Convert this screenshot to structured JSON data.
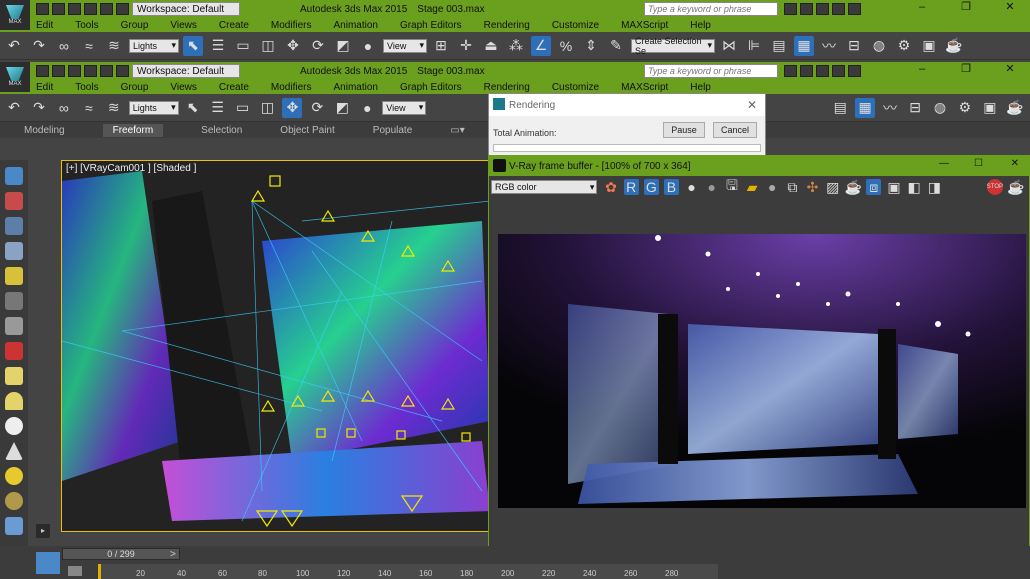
{
  "app": {
    "logo_text": "MAX",
    "workspace": "Workspace: Default",
    "title": "Autodesk 3ds Max  2015",
    "file": "Stage 003.max",
    "search_placeholder": "Type a keyword or phrase",
    "win_min": "–",
    "win_max": "❐",
    "win_close": "✕"
  },
  "menu": [
    "Edit",
    "Tools",
    "Group",
    "Views",
    "Create",
    "Modifiers",
    "Animation",
    "Graph Editors",
    "Rendering",
    "Customize",
    "MAXScript",
    "Help"
  ],
  "toolbar": {
    "selection_filter": "Lights",
    "ref_coord": "View",
    "create_selection_set": "Create Selection Se"
  },
  "ribbon": {
    "tabs": [
      "Modeling",
      "Freeform",
      "Selection",
      "Object Paint",
      "Populate"
    ],
    "active": "Freeform"
  },
  "viewport": {
    "label": "[+] [VRayCam001 ] [Shaded ]"
  },
  "render_dialog": {
    "title": "Rendering",
    "total_animation": "Total Animation:",
    "pause": "Pause",
    "cancel": "Cancel"
  },
  "vfb": {
    "title": "V-Ray frame buffer - [100% of 700 x 364]",
    "channel": "RGB color",
    "channels": [
      "R",
      "G",
      "B"
    ]
  },
  "timeline": {
    "frame": "0 / 299",
    "ticks": [
      "20",
      "40",
      "60",
      "80",
      "100",
      "120",
      "140",
      "160",
      "180",
      "200",
      "220",
      "240",
      "260",
      "280"
    ]
  },
  "colors": {
    "accent": "#6b9f1e",
    "active_blue": "#2d6fb8",
    "selection": "#f0c000"
  }
}
